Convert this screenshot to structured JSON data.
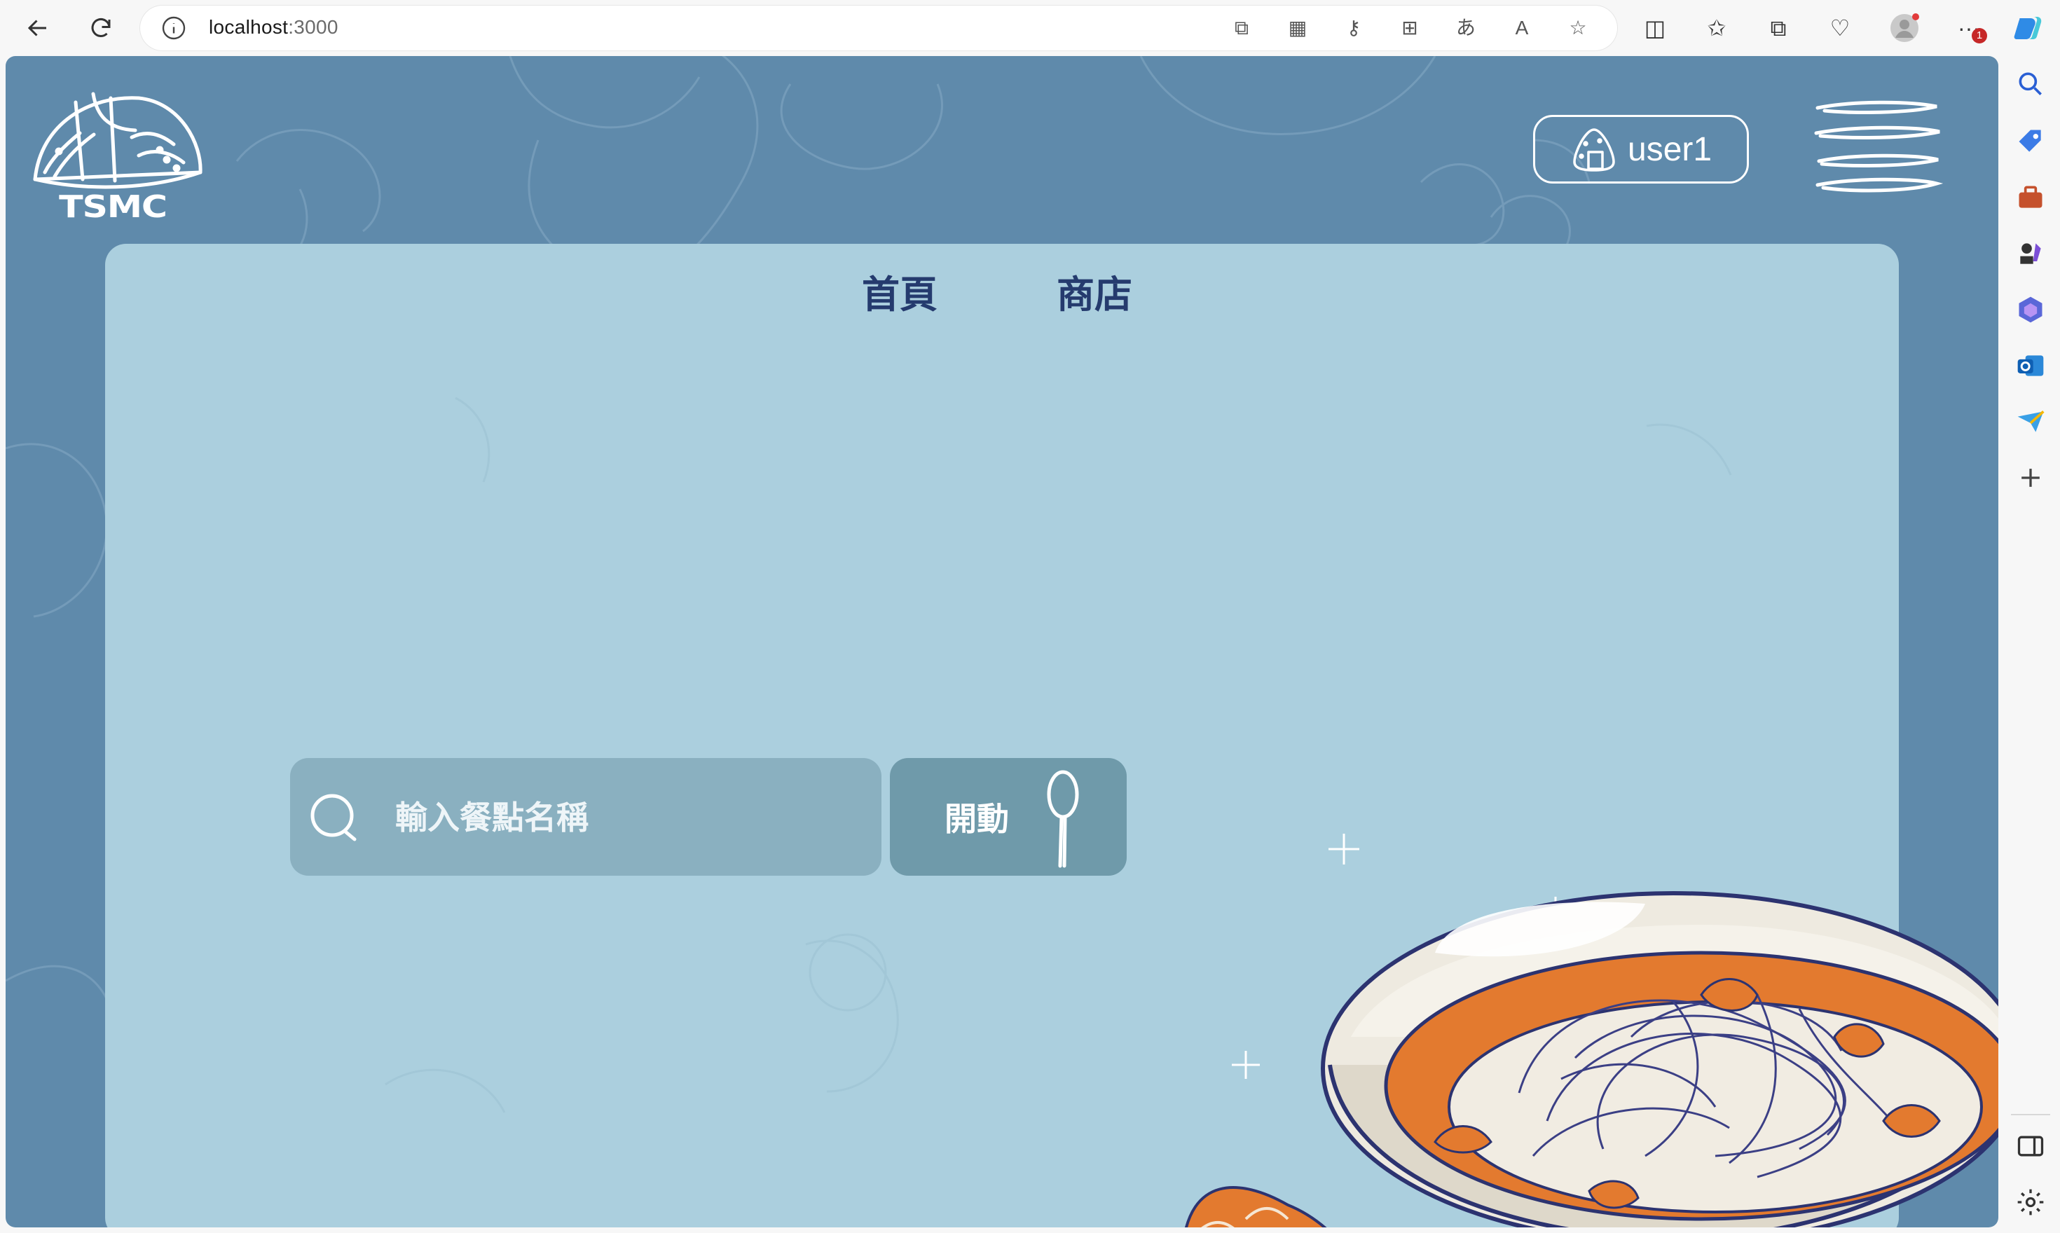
{
  "browser": {
    "url_host": "localhost",
    "url_port": ":3000",
    "notification_badge": "1"
  },
  "site": {
    "logo_text": "TSMC",
    "user_label": "user1"
  },
  "nav": {
    "home": "首頁",
    "shop": "商店"
  },
  "search": {
    "placeholder": "輸入餐點名稱",
    "button_label": "開動"
  },
  "colors": {
    "page_background": "#5f8aab",
    "panel_background": "#abcfde",
    "nav_text": "#253b6e",
    "search_box": "#8ab0c0",
    "search_button": "#6f9aaa"
  }
}
